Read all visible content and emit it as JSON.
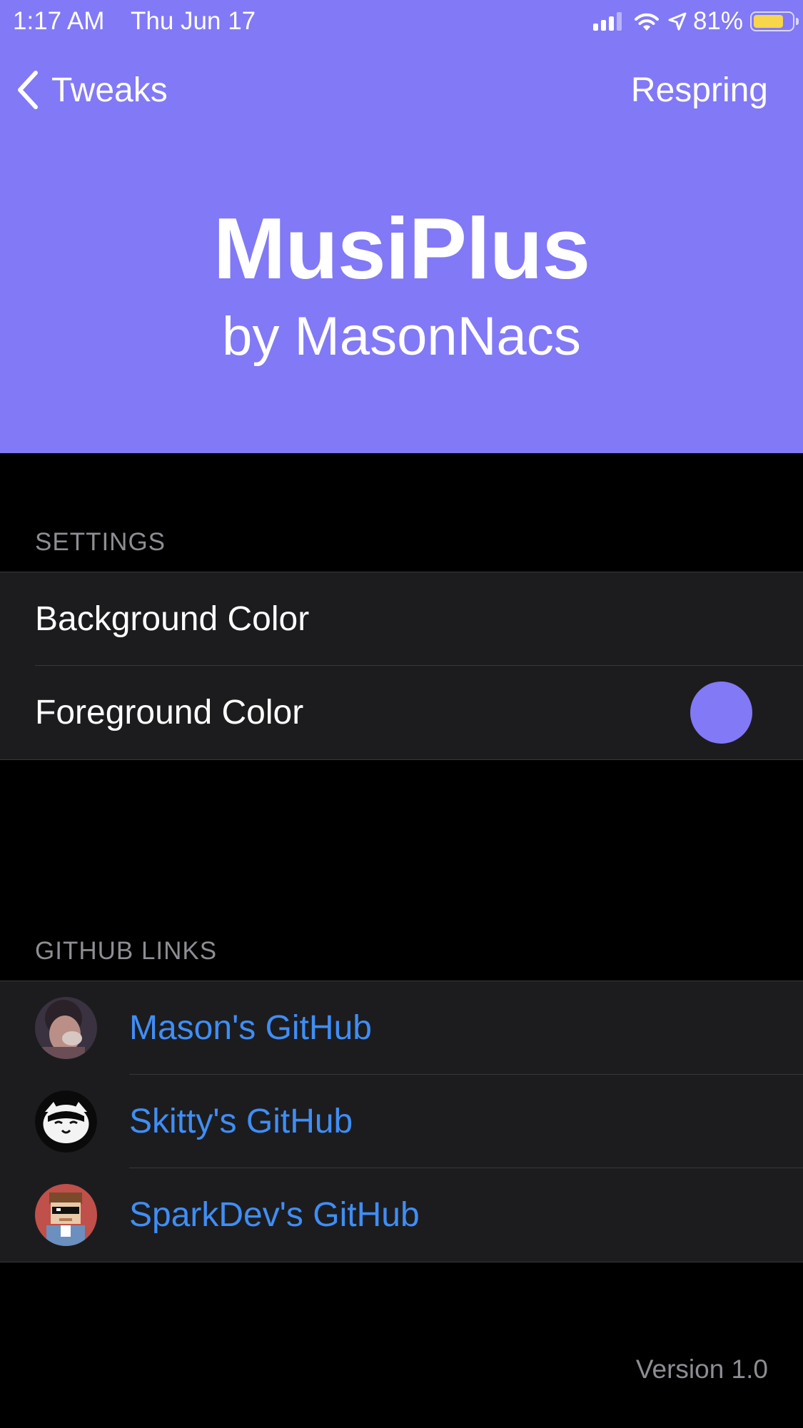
{
  "status_bar": {
    "time": "1:17 AM",
    "date": "Thu Jun 17",
    "battery_percent": "81%",
    "battery_level": 0.81,
    "icons": [
      "cellular-signal-icon",
      "wifi-icon",
      "location-arrow-icon",
      "battery-icon"
    ]
  },
  "nav": {
    "back_label": "Tweaks",
    "right_label": "Respring"
  },
  "hero": {
    "title": "MusiPlus",
    "subtitle": "by MasonNacs"
  },
  "settings": {
    "header": "SETTINGS",
    "rows": [
      {
        "label": "Background Color",
        "color": "#1c1c1e"
      },
      {
        "label": "Foreground Color",
        "color": "#8279f6"
      }
    ]
  },
  "links": {
    "header": "GITHUB LINKS",
    "rows": [
      {
        "label": "Mason's GitHub",
        "avatar": "mason-avatar"
      },
      {
        "label": "Skitty's GitHub",
        "avatar": "skitty-avatar"
      },
      {
        "label": "SparkDev's GitHub",
        "avatar": "sparkdev-avatar"
      }
    ]
  },
  "footer": {
    "version": "Version 1.0"
  },
  "colors": {
    "accent": "#8279f6",
    "link": "#3f8ef5",
    "background": "#000000",
    "cell": "#1c1c1e",
    "secondary_text": "#8d8d93"
  }
}
